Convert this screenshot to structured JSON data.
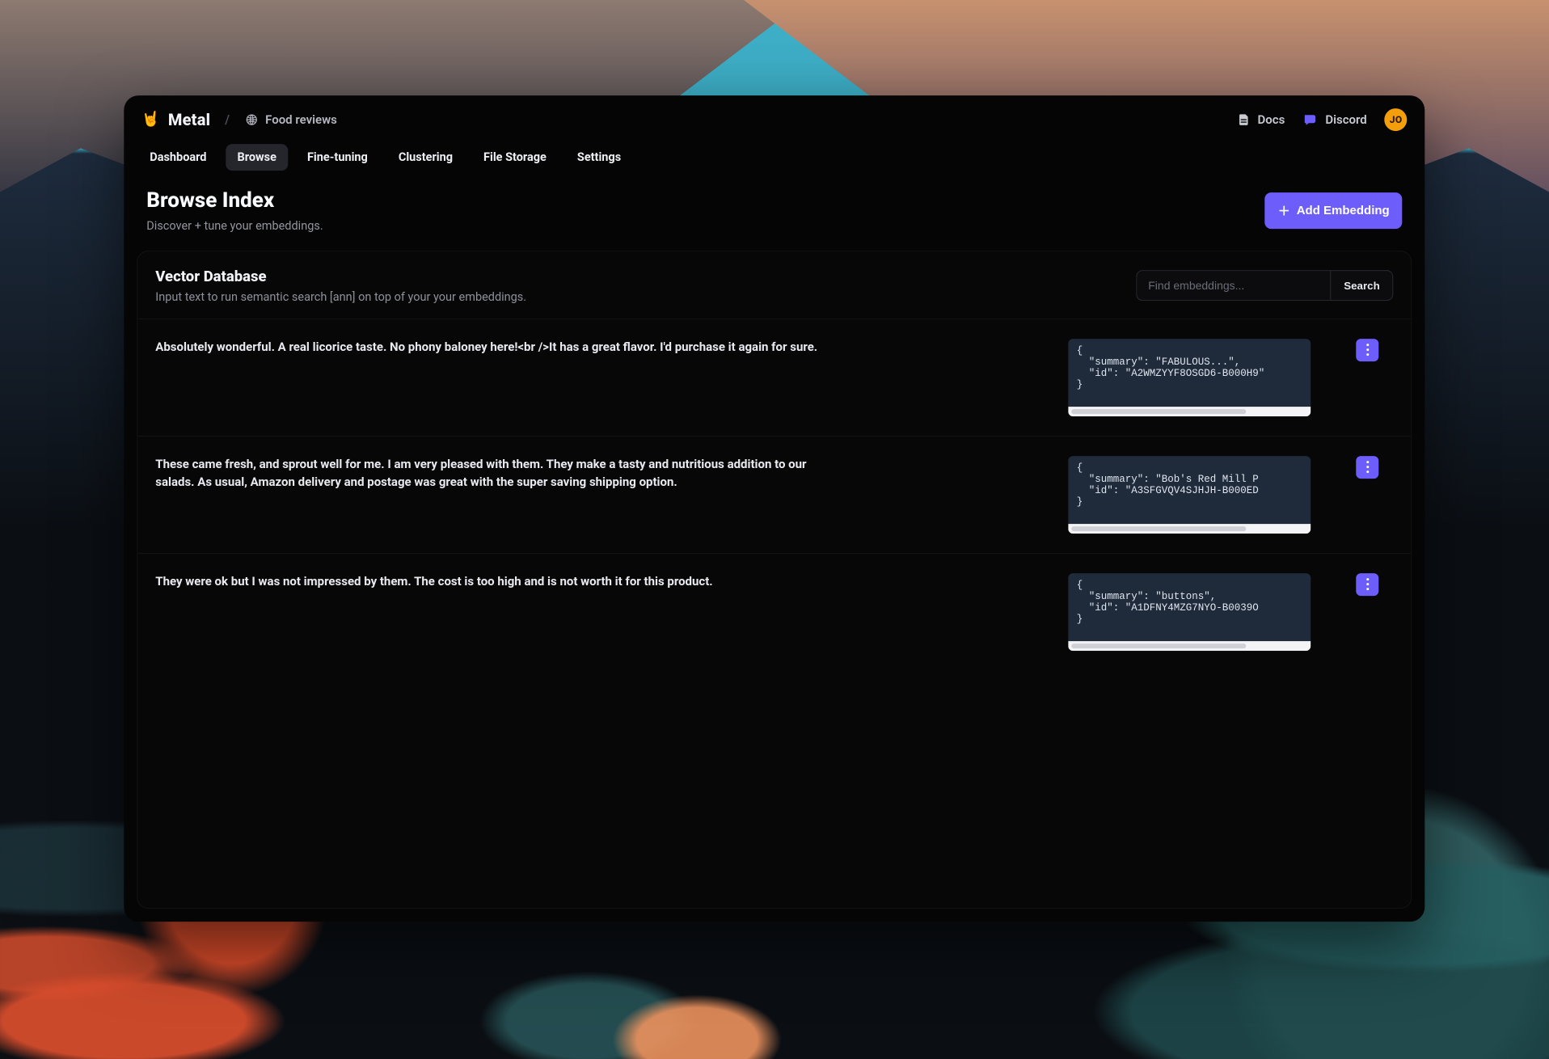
{
  "brand": {
    "name": "Metal"
  },
  "breadcrumb": {
    "project": "Food reviews"
  },
  "top_links": {
    "docs": "Docs",
    "discord": "Discord"
  },
  "avatar": {
    "initials": "JO"
  },
  "tabs": [
    {
      "label": "Dashboard",
      "active": false
    },
    {
      "label": "Browse",
      "active": true
    },
    {
      "label": "Fine-tuning",
      "active": false
    },
    {
      "label": "Clustering",
      "active": false
    },
    {
      "label": "File Storage",
      "active": false
    },
    {
      "label": "Settings",
      "active": false
    }
  ],
  "page": {
    "title": "Browse Index",
    "subtitle": "Discover + tune your embeddings.",
    "add_button": "Add Embedding"
  },
  "card": {
    "title": "Vector Database",
    "subtitle": "Input text to run semantic search [ann] on top of your your embeddings.",
    "search_placeholder": "Find embeddings...",
    "search_button": "Search"
  },
  "rows": [
    {
      "text": "Absolutely wonderful. A real licorice taste. No phony baloney here!<br />It has a great flavor. I'd purchase it again for sure.",
      "code": "{\n  \"summary\": \"FABULOUS...\",\n  \"id\": \"A2WMZYYF8OSGD6-B000H9\"\n}"
    },
    {
      "text": "These came fresh, and sprout well for me. I am very pleased with them. They make a tasty and nutritious addition to our salads. As usual, Amazon delivery and postage was great with the super saving shipping option.",
      "code": "{\n  \"summary\": \"Bob's Red Mill P\n  \"id\": \"A3SFGVQV4SJHJH-B000ED\n}"
    },
    {
      "text": "They were ok but I was not impressed by them. The cost is too high and is not worth it for this product.",
      "code": "{\n  \"summary\": \"buttons\",\n  \"id\": \"A1DFNY4MZG7NYO-B0039O\n}"
    }
  ]
}
